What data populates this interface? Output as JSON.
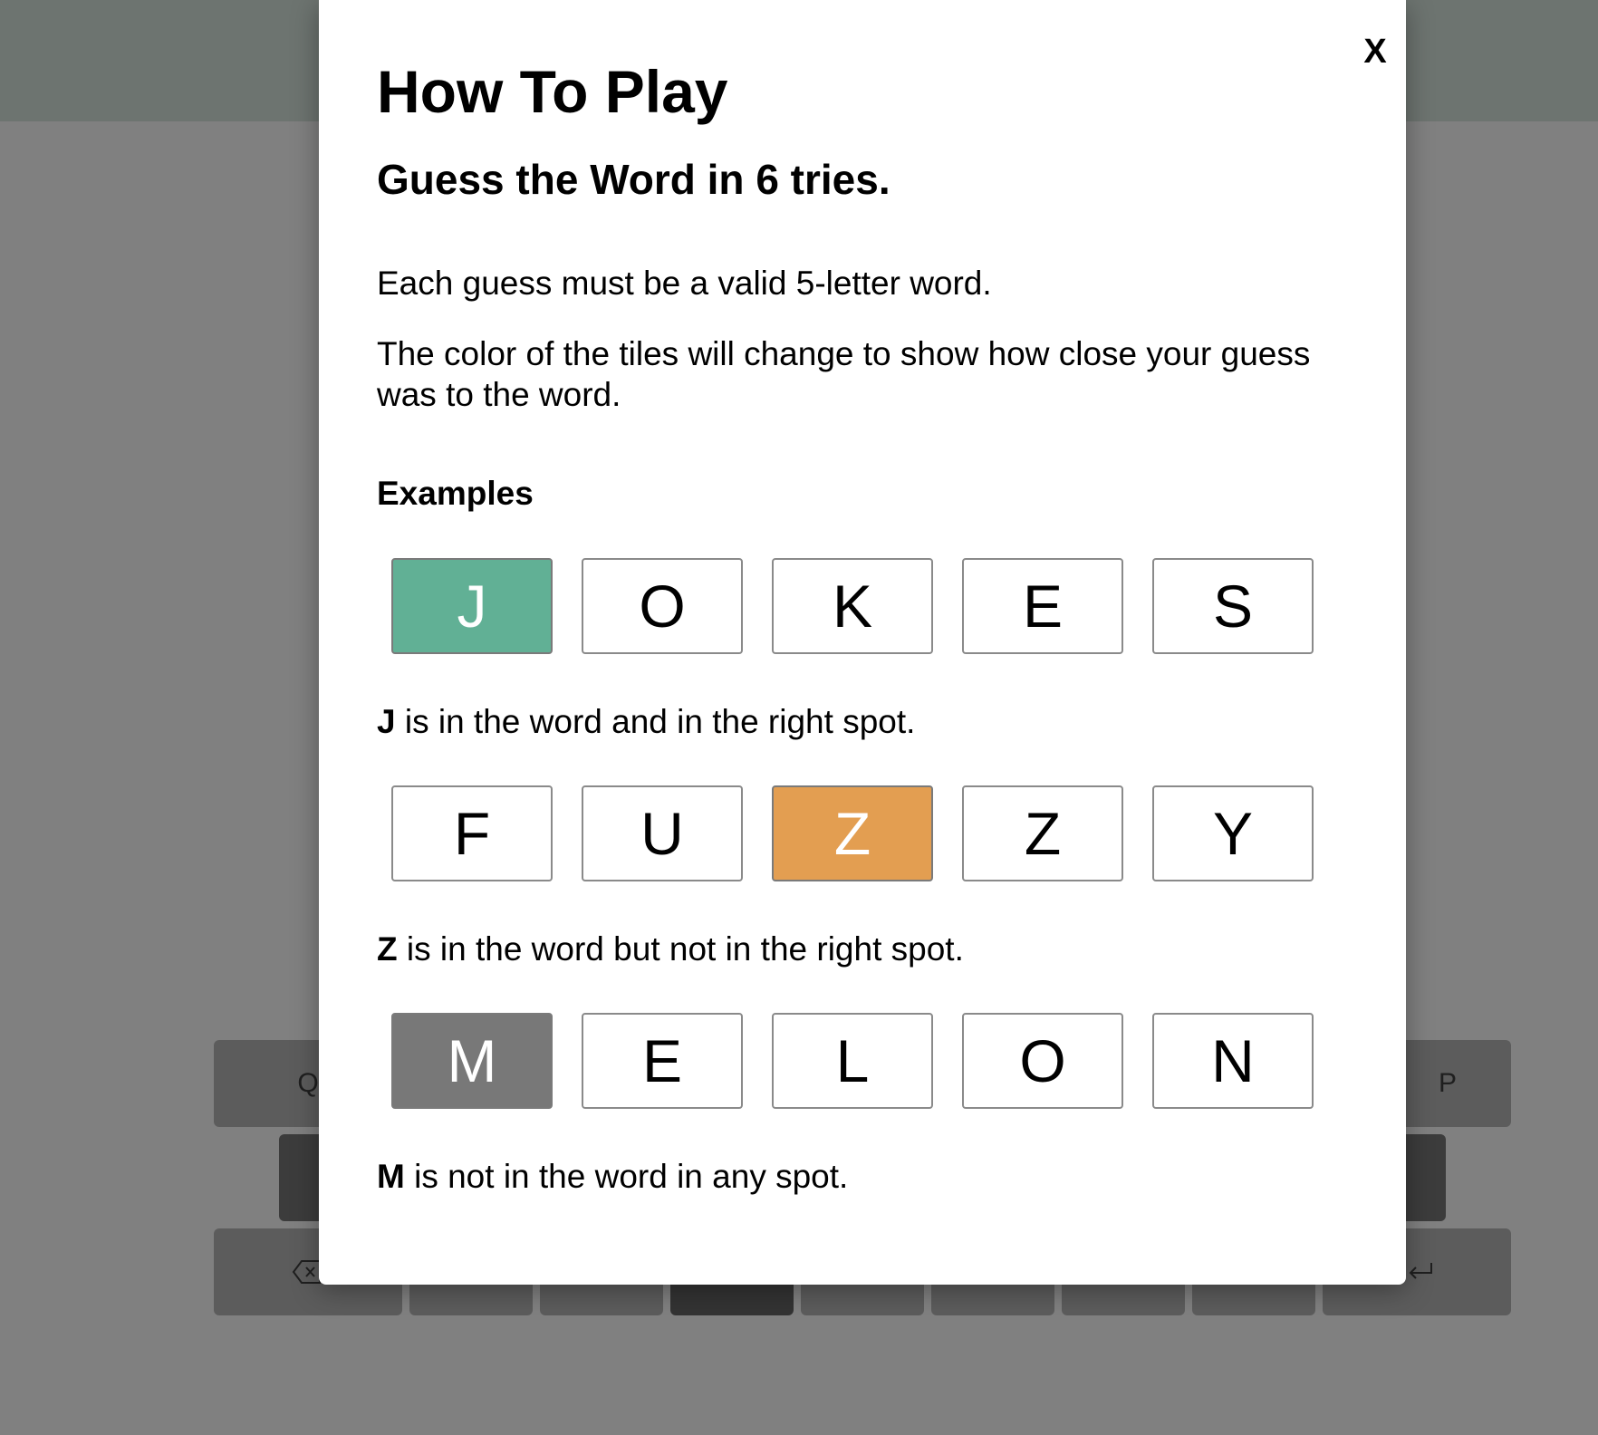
{
  "keyboard": {
    "row1_first": "Q",
    "row1_last": "P",
    "backspace_icon": "backspace-icon",
    "enter_icon": "enter-icon"
  },
  "modal": {
    "close_label": "X",
    "title": "How To Play",
    "subtitle": "Guess the Word in 6 tries.",
    "paragraph1": "Each guess must be a valid 5-letter word.",
    "paragraph2": "The color of the tiles will change to show how close your guess was to the word.",
    "examples_heading": "Examples",
    "examples": [
      {
        "tiles": [
          {
            "letter": "J",
            "state": "correct"
          },
          {
            "letter": "O",
            "state": "empty"
          },
          {
            "letter": "K",
            "state": "empty"
          },
          {
            "letter": "E",
            "state": "empty"
          },
          {
            "letter": "S",
            "state": "empty"
          }
        ],
        "highlight_letter": "J",
        "explanation": " is in the word and in the right spot."
      },
      {
        "tiles": [
          {
            "letter": "F",
            "state": "empty"
          },
          {
            "letter": "U",
            "state": "empty"
          },
          {
            "letter": "Z",
            "state": "present"
          },
          {
            "letter": "Z",
            "state": "empty"
          },
          {
            "letter": "Y",
            "state": "empty"
          }
        ],
        "highlight_letter": "Z",
        "explanation": " is in the word but not in the right spot."
      },
      {
        "tiles": [
          {
            "letter": "M",
            "state": "absent"
          },
          {
            "letter": "E",
            "state": "empty"
          },
          {
            "letter": "L",
            "state": "empty"
          },
          {
            "letter": "O",
            "state": "empty"
          },
          {
            "letter": "N",
            "state": "empty"
          }
        ],
        "highlight_letter": "M",
        "explanation": " is not in the word in any spot."
      }
    ]
  },
  "colors": {
    "correct": "#61b095",
    "present": "#e39e51",
    "absent": "#787878",
    "overlay": "#808080"
  }
}
